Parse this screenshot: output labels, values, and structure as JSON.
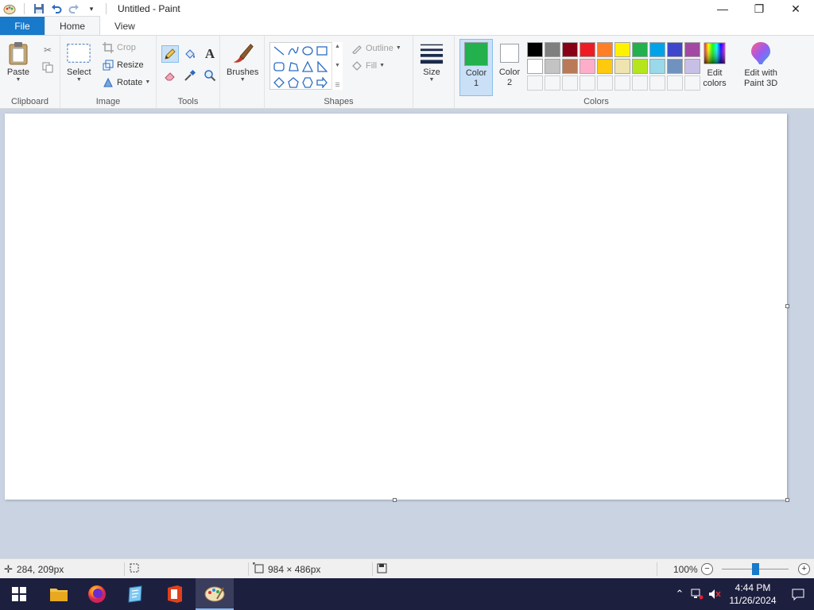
{
  "window": {
    "title": "Untitled - Paint",
    "controls": {
      "minimize": "—",
      "maximize": "❐",
      "close": "✕"
    }
  },
  "quick_access": {
    "save_icon": "save-icon",
    "undo_icon": "undo-icon",
    "redo_icon": "redo-icon",
    "customize_icon": "chevron-down-icon"
  },
  "tabs": [
    {
      "label": "File",
      "kind": "file"
    },
    {
      "label": "Home",
      "kind": "active"
    },
    {
      "label": "View",
      "kind": "normal"
    }
  ],
  "ribbon": {
    "clipboard": {
      "label": "Clipboard",
      "paste": "Paste"
    },
    "image": {
      "label": "Image",
      "select": "Select",
      "crop": "Crop",
      "resize": "Resize",
      "rotate": "Rotate"
    },
    "tools": {
      "label": "Tools"
    },
    "brushes": {
      "label": "Brushes"
    },
    "shapes": {
      "label": "Shapes",
      "outline": "Outline",
      "fill": "Fill"
    },
    "size": {
      "label": "Size"
    },
    "colors": {
      "label": "Colors",
      "color1_line1": "Color",
      "color1_line2": "1",
      "color2_line1": "Color",
      "color2_line2": "2",
      "color1_value": "#22b14c",
      "color2_value": "#ffffff",
      "edit_colors_line1": "Edit",
      "edit_colors_line2": "colors",
      "paint3d_line1": "Edit with",
      "paint3d_line2": "Paint 3D",
      "palette": [
        "#000000",
        "#7f7f7f",
        "#880015",
        "#ed1c24",
        "#ff7f27",
        "#fff200",
        "#22b14c",
        "#00a2e8",
        "#3f48cc",
        "#a349a4",
        "#ffffff",
        "#c3c3c3",
        "#b97a57",
        "#ffaec9",
        "#ffc90e",
        "#efe4b0",
        "#b5e61d",
        "#99d9ea",
        "#7092be",
        "#c8bfe7",
        "#f5f6f7",
        "#f5f6f7",
        "#f5f6f7",
        "#f5f6f7",
        "#f5f6f7",
        "#f5f6f7",
        "#f5f6f7",
        "#f5f6f7",
        "#f5f6f7",
        "#f5f6f7"
      ]
    }
  },
  "canvas": {
    "note": ""
  },
  "status": {
    "cursor_pos": "284, 209px",
    "canvas_size": "984 × 486px",
    "zoom": "100%",
    "zoom_fraction": 0.5
  },
  "taskbar": {
    "time": "4:44 PM",
    "date": "11/26/2024"
  }
}
